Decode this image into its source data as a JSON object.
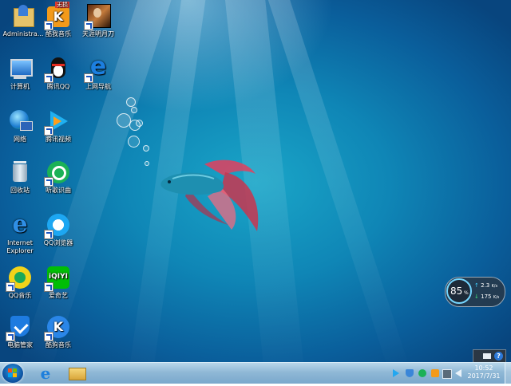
{
  "desktop_icons": [
    {
      "label": "Administra...",
      "badge": ""
    },
    {
      "label": "酷我音乐",
      "badge": "无损"
    },
    {
      "label": "天涯明月刀",
      "badge": ""
    },
    {
      "label": "计算机",
      "badge": ""
    },
    {
      "label": "腾讯QQ",
      "badge": ""
    },
    {
      "label": "上网导航",
      "badge": ""
    },
    {
      "label": "网络",
      "badge": ""
    },
    {
      "label": "腾讯视频",
      "badge": ""
    },
    {
      "label": "回收站",
      "badge": ""
    },
    {
      "label": "听歌识曲",
      "badge": ""
    },
    {
      "label": "Internet\nExplorer",
      "badge": ""
    },
    {
      "label": "QQ浏览器",
      "badge": ""
    },
    {
      "label": "QQ音乐",
      "badge": ""
    },
    {
      "label": "爱奇艺",
      "badge": ""
    },
    {
      "label": "电脑管家",
      "badge": ""
    },
    {
      "label": "酷狗音乐",
      "badge": ""
    }
  ],
  "speed_widget": {
    "percent": "85",
    "percent_unit": "%",
    "upload": "2.3",
    "upload_unit": "K/s",
    "download": "175",
    "download_unit": "K/s"
  },
  "taskbar": {
    "clock_time": "10:52",
    "clock_date": "2017/7/31",
    "pinned": [
      "internet-explorer-icon",
      "file-explorer-icon"
    ]
  },
  "colors": {
    "desktop_top": "#1aa6c8",
    "desktop_bottom": "#08457e",
    "taskbar": "#8fb8d6"
  }
}
